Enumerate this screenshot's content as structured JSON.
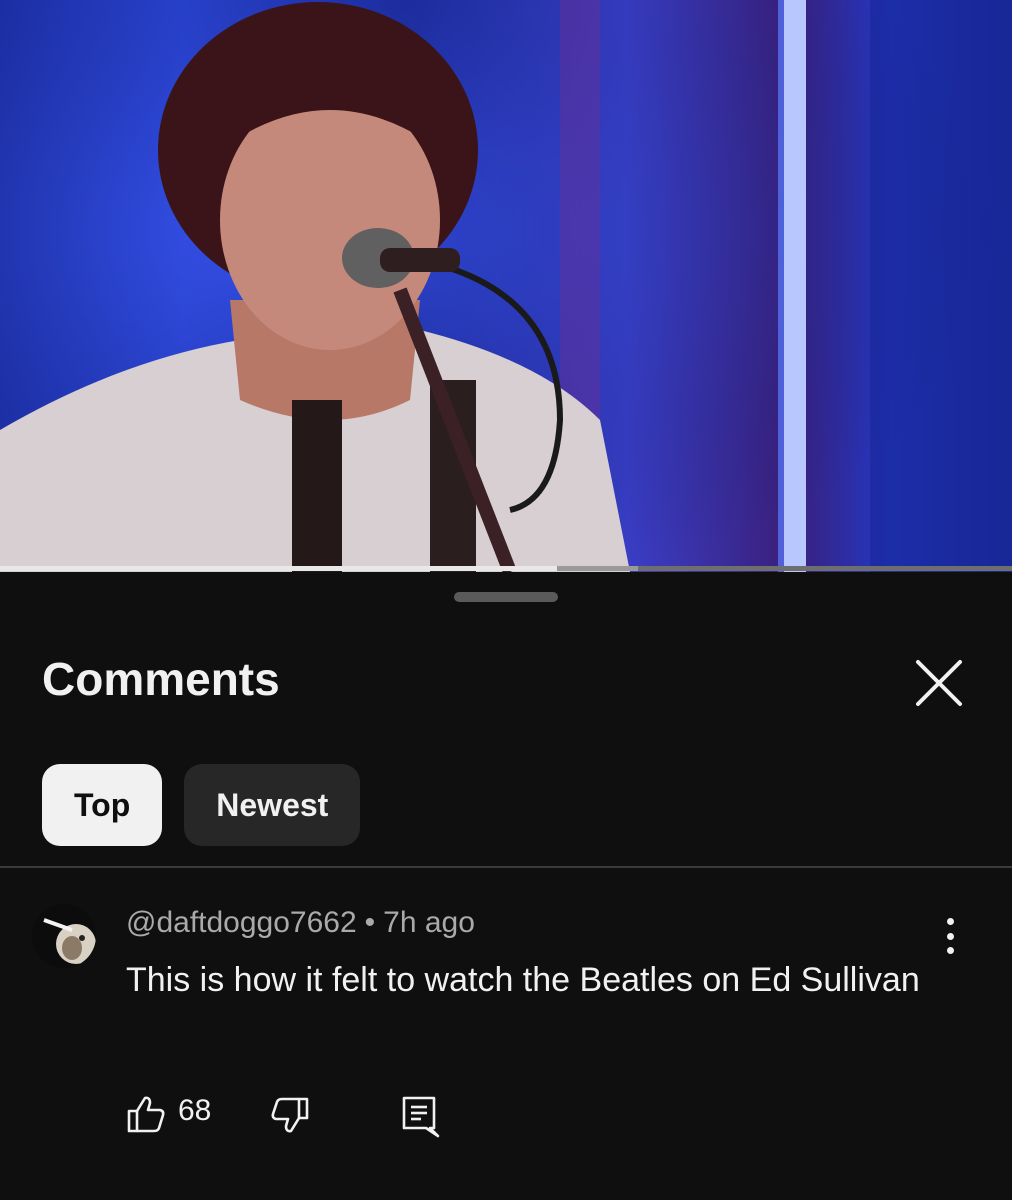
{
  "video": {
    "progress_played": 0.55,
    "progress_buffered": 0.63
  },
  "comments_sheet": {
    "title": "Comments",
    "close_icon": "close-icon",
    "filters": [
      {
        "label": "Top",
        "selected": true
      },
      {
        "label": "Newest",
        "selected": false
      }
    ]
  },
  "comment": {
    "author": "@daftdoggo7662",
    "separator": "•",
    "time": "7h ago",
    "text": "This is how it felt to watch the Beatles on Ed Sullivan",
    "like_count": "68",
    "icons": {
      "like": "thumbs-up-icon",
      "dislike": "thumbs-down-icon",
      "reply": "reply-icon",
      "more": "more-vertical-icon"
    }
  },
  "colors": {
    "background": "#0f0f0f",
    "text_primary": "#f1f1f1",
    "text_secondary": "#aaaaaa",
    "chip_selected_bg": "#f1f1f1",
    "chip_unselected_bg": "#272727"
  }
}
